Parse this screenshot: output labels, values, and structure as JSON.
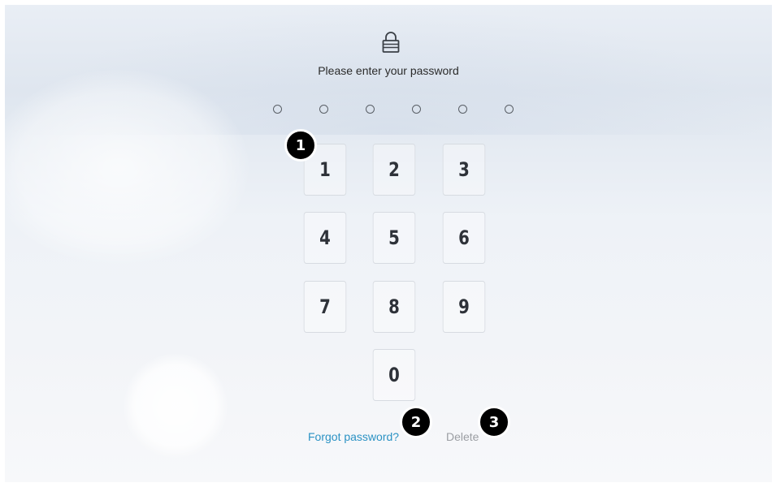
{
  "header": {
    "icon": "lock-icon",
    "prompt": "Please enter your password"
  },
  "password": {
    "length": 6,
    "entered": 0
  },
  "keypad": {
    "keys": [
      "1",
      "2",
      "3",
      "4",
      "5",
      "6",
      "7",
      "8",
      "9",
      "0"
    ]
  },
  "actions": {
    "forgot_label": "Forgot password?",
    "delete_label": "Delete"
  },
  "annotations": {
    "badges": [
      "1",
      "2",
      "3"
    ]
  },
  "colors": {
    "link": "#2b92c4",
    "delete": "#9b9ea3",
    "badge": "#000000"
  }
}
